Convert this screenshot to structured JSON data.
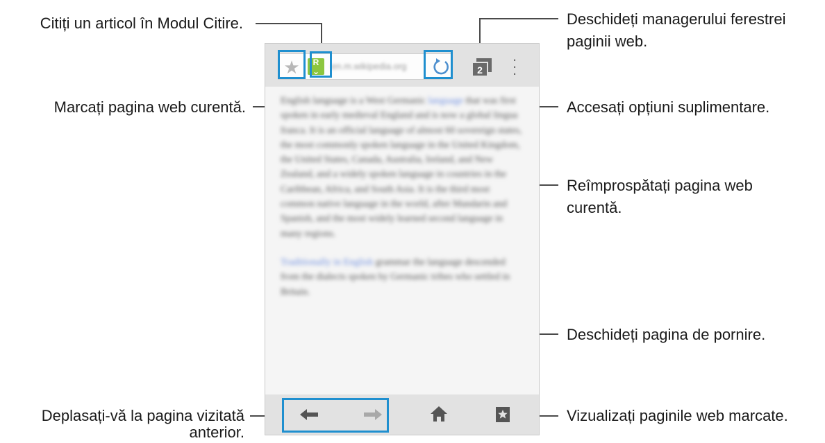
{
  "callouts": {
    "reader_mode": "Citiți un articol în Modul Citire.",
    "bookmark_page": "Marcați pagina web curentă.",
    "back_line1": "Deplasați-vă la pagina vizitată",
    "back_line2": "anterior.",
    "window_manager_line1": "Deschideți managerului ferestrei",
    "window_manager_line2": "paginii web.",
    "more_options": "Accesați opțiuni suplimentare.",
    "refresh_line1": "Reîmprospătați pagina web",
    "refresh_line2": "curentă.",
    "home": "Deschideți pagina de pornire.",
    "bookmarks": "Vizualizați paginile web marcate."
  },
  "browser": {
    "reader_icon_glyph": "R",
    "window_count": "2",
    "url_text": "en.m.wikipedia.org"
  },
  "page_content": {
    "paragraph1_lead": "English language is a West Germanic",
    "paragraph1_link": "language",
    "paragraph1_rest": "that was first spoken in early medieval England and is now a global lingua franca. It is an official language of almost 60 sovereign states, the most commonly spoken language in the United Kingdom, the United States, Canada, Australia, Ireland, and New Zealand, and a widely spoken language in countries in the Caribbean, Africa, and South Asia. It is the third most common native language in the world, after Mandarin and Spanish, and the most widely learned second language in many regions.",
    "paragraph2_link": "Traditionally in English",
    "paragraph2_rest": "grammar the language descended from the dialects spoken by Germanic tribes who settled in Britain."
  },
  "colors": {
    "highlight": "#1f8fcf",
    "reader_icon": "#8cc63f",
    "bar_background": "#e2e2e2"
  },
  "icons": {
    "bookmark": "star-icon",
    "reader": "reader-mode-icon",
    "refresh": "refresh-icon",
    "windows": "windows-icon",
    "menu": "more-options-icon",
    "back": "arrow-left-icon",
    "forward": "arrow-right-icon",
    "home": "home-icon",
    "bookmarks": "bookmarks-icon"
  }
}
